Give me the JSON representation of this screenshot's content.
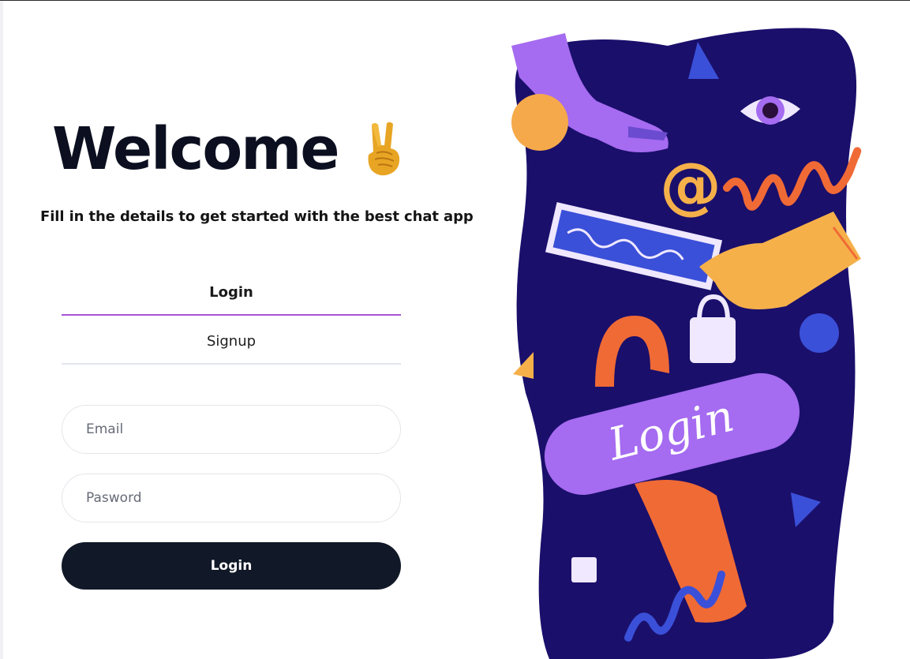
{
  "hero": {
    "title": "Welcome",
    "title_icon": "victory-hand-icon",
    "subtitle": "Fill in the details to get started with the best chat app"
  },
  "tabs": [
    {
      "label": "Login",
      "active": true
    },
    {
      "label": "Signup",
      "active": false
    }
  ],
  "form": {
    "email_placeholder": "Email",
    "password_placeholder": "Pasword",
    "submit_label": "Login"
  },
  "illustration": {
    "button_text": "Login",
    "at_symbol": "@",
    "colors": {
      "background_blob": "#1a0f6b",
      "purple": "#a56bf0",
      "orange": "#f06a35",
      "yellow": "#f5b04a",
      "blue": "#3b50d8"
    }
  },
  "colors": {
    "active_tab_underline": "#a855d8",
    "inactive_tab_underline": "#e2e5ee",
    "button_bg": "#111827"
  }
}
